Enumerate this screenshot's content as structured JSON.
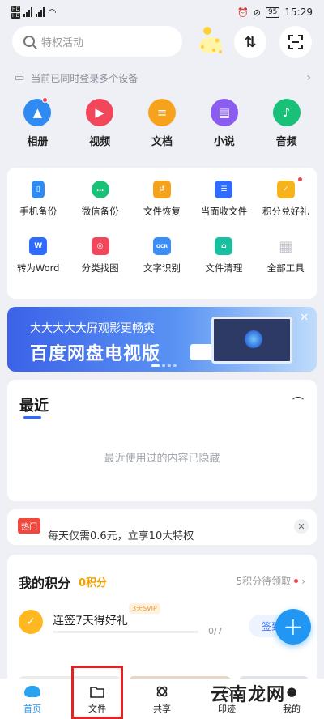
{
  "status_bar": {
    "time": "15:29",
    "battery": "95"
  },
  "header": {
    "search_placeholder": "特权活动"
  },
  "devices": {
    "text": "当前已同时登录多个设备"
  },
  "categories": [
    {
      "label": "相册",
      "color": "#2f8bf2",
      "icon": "photo-icon"
    },
    {
      "label": "视频",
      "color": "#f2475b",
      "icon": "video-icon"
    },
    {
      "label": "文档",
      "color": "#f7a21b",
      "icon": "document-icon"
    },
    {
      "label": "小说",
      "color": "#8a5cf0",
      "icon": "book-icon"
    },
    {
      "label": "音频",
      "color": "#19c078",
      "icon": "music-icon"
    }
  ],
  "tools": [
    {
      "label": "手机备份",
      "color": "#2f8bf2",
      "icon": "phone-backup-icon"
    },
    {
      "label": "微信备份",
      "color": "#19c078",
      "icon": "wechat-icon"
    },
    {
      "label": "文件恢复",
      "color": "#f7a21b",
      "icon": "file-restore-icon"
    },
    {
      "label": "当面收文件",
      "color": "#2f6bff",
      "icon": "receive-file-icon"
    },
    {
      "label": "积分兑好礼",
      "color": "#f7b31b",
      "icon": "gift-icon"
    },
    {
      "label": "转为Word",
      "color": "#2f6bff",
      "icon": "word-icon",
      "glyph": "W"
    },
    {
      "label": "分类找图",
      "color": "#f2475b",
      "icon": "image-search-icon"
    },
    {
      "label": "文字识别",
      "color": "#3a8ef6",
      "icon": "ocr-icon",
      "glyph": "OCR"
    },
    {
      "label": "文件清理",
      "color": "#19c0a0",
      "icon": "clean-icon"
    },
    {
      "label": "全部工具",
      "color": "#c4c8d0",
      "icon": "all-tools-icon"
    }
  ],
  "banner": {
    "subtitle": "大大大大大屏观影更畅爽",
    "title": "百度网盘电视版"
  },
  "recent": {
    "title": "最近",
    "hidden_text": "最近使用过的内容已隐藏"
  },
  "hot": {
    "tag": "热门",
    "text": "每天仅需0.6元，立享10大特权"
  },
  "points": {
    "title": "我的积分",
    "count": "0积分",
    "pending": "5积分待领取",
    "checkin_text": "连签7天得好礼",
    "svip_tag": "3天SVIP",
    "progress_label": "0/7",
    "progress_fraction": 0,
    "sign_label": "签到"
  },
  "tabs": [
    {
      "label": "首页",
      "icon": "home-icon"
    },
    {
      "label": "文件",
      "icon": "folder-icon"
    },
    {
      "label": "共享",
      "icon": "share-icon"
    },
    {
      "label": "印迹",
      "icon": "footprint-icon"
    },
    {
      "label": "我的",
      "icon": "profile-icon"
    }
  ],
  "watermark": "云南龙网"
}
